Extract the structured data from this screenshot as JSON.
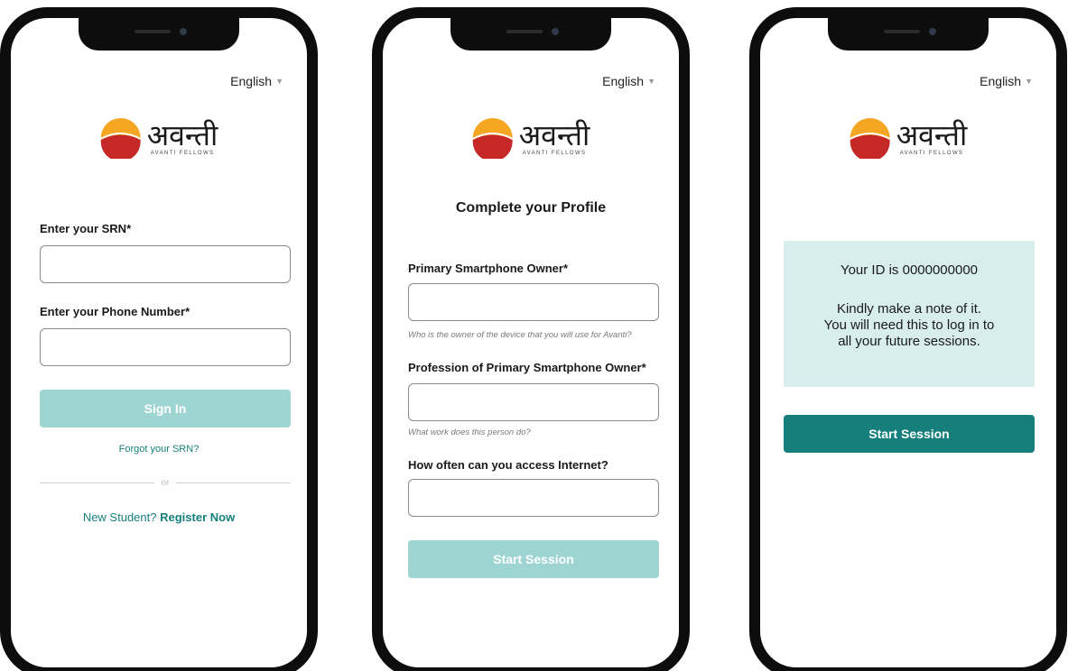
{
  "language": "English",
  "brand": {
    "hindi": "अवन्ती",
    "english": "AVANTI FELLOWS"
  },
  "signin": {
    "srn_label": "Enter your SRN*",
    "phone_label": "Enter your Phone Number*",
    "button": "Sign In",
    "forgot": "Forgot your SRN?",
    "or": "or",
    "new_student": "New Student?",
    "register": "Register Now"
  },
  "profile": {
    "title": "Complete your Profile",
    "owner_label": "Primary Smartphone Owner*",
    "owner_hint": "Who is the owner of the device that you will use for Avanti?",
    "profession_label": "Profession of Primary Smartphone Owner*",
    "profession_hint": "What work does this person do?",
    "internet_label": "How often can you access Internet?",
    "button": "Start Session"
  },
  "confirm": {
    "id_text": "Your ID is 0000000000",
    "note_1": "Kindly make a note of it.",
    "note_2": "You will need this to log in to",
    "note_3": "all your future sessions.",
    "button": "Start Session"
  },
  "colors": {
    "teal": "#167f7b",
    "teal_disabled": "#9ed4d1",
    "info_bg": "#d8eeed",
    "logo_red": "#c62828",
    "logo_yellow": "#f5a623"
  }
}
